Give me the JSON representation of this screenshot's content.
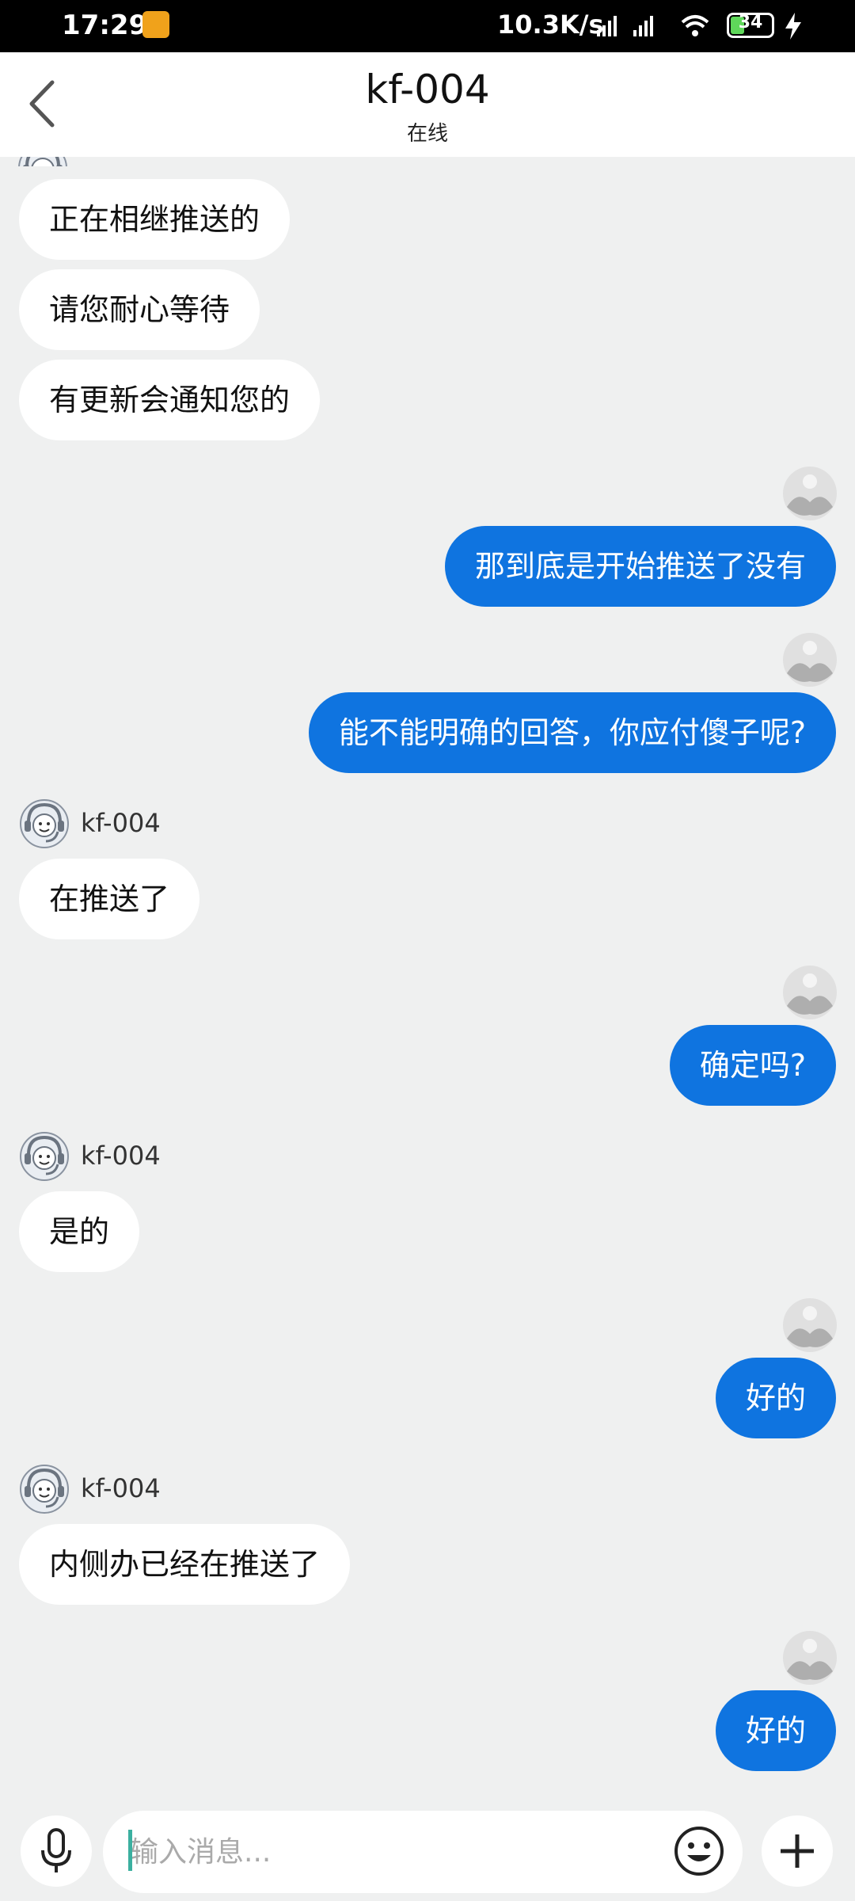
{
  "status_bar": {
    "time": "17:29",
    "network_speed": "10.3K/s",
    "battery": "34",
    "battery_level": 0.34
  },
  "header": {
    "title": "kf-004",
    "subtitle": "在线"
  },
  "messages": [
    {
      "text": "正在相继推送的"
    },
    {
      "text": "请您耐心等待"
    },
    {
      "text": "有更新会通知您的"
    },
    {
      "text": "那到底是开始推送了没有"
    },
    {
      "text": "能不能明确的回答，你应付傻子呢?"
    },
    {
      "sender": "kf-004",
      "text": "在推送了"
    },
    {
      "text": "确定吗?"
    },
    {
      "sender": "kf-004",
      "text": "是的"
    },
    {
      "text": "好的"
    },
    {
      "sender": "kf-004",
      "text": "内侧办已经在推送了"
    },
    {
      "text": "好的"
    }
  ],
  "input": {
    "placeholder": "输入消息..."
  },
  "icons": {
    "back": "chevron-left-icon",
    "mic": "microphone-icon",
    "emoji": "smiley-icon",
    "plus": "plus-icon",
    "agent_avatar": "headset-agent-icon",
    "user_avatar": "default-user-icon"
  }
}
